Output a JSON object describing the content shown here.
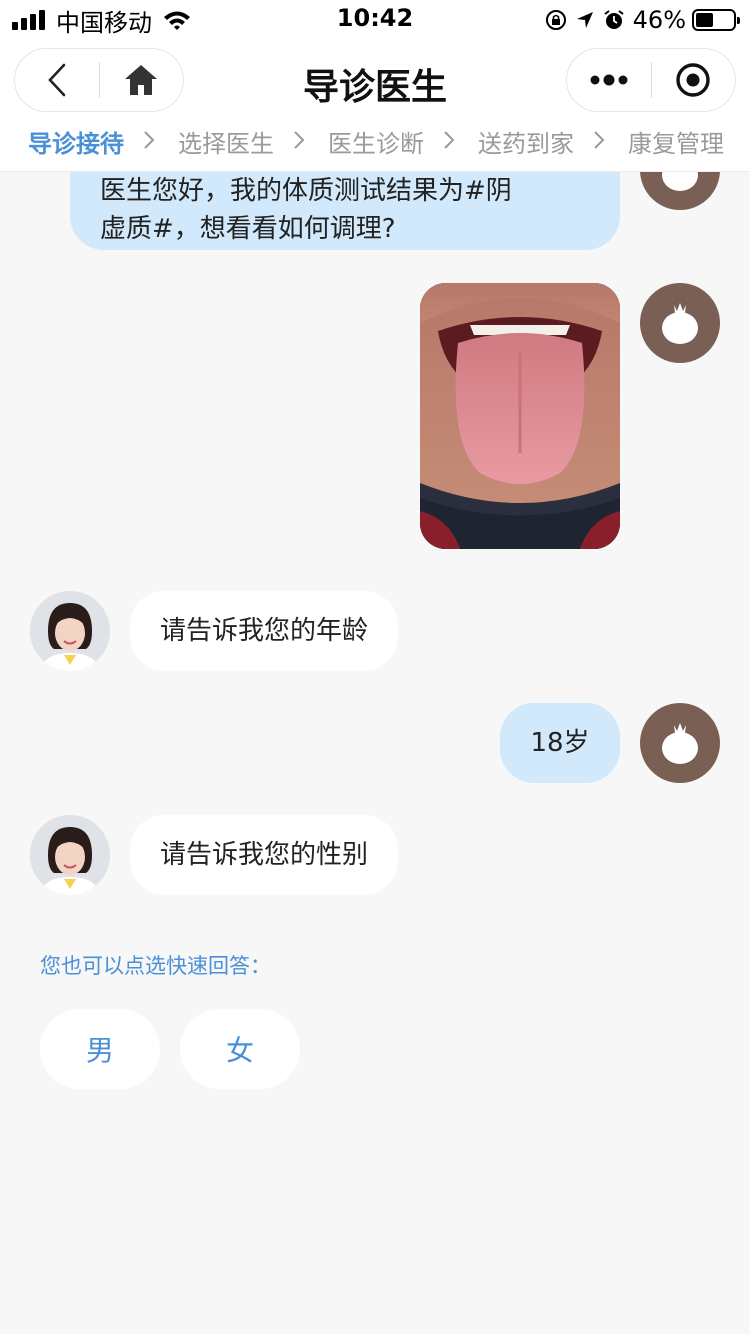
{
  "status_bar": {
    "carrier": "中国移动",
    "time": "10:42",
    "battery_percent_label": "46%",
    "battery_level": 0.46
  },
  "nav": {
    "title": "导诊医生",
    "left_icons": [
      "chevron-left-icon",
      "home-icon"
    ],
    "right_icons": [
      "more-icon",
      "record-icon"
    ]
  },
  "steps": [
    {
      "label": "导诊接待",
      "active": true
    },
    {
      "label": "选择医生",
      "active": false
    },
    {
      "label": "医生诊断",
      "active": false
    },
    {
      "label": "送药到家",
      "active": false
    },
    {
      "label": "康复管理",
      "active": false
    }
  ],
  "messages": [
    {
      "from": "user",
      "type": "text",
      "lines": [
        "医生您好，我的体质测试结果为#阴",
        "虚质#，想看看如何调理?"
      ]
    },
    {
      "from": "user",
      "type": "image",
      "subject": "tongue-photo"
    },
    {
      "from": "doctor",
      "type": "text",
      "text": "请告诉我您的年龄"
    },
    {
      "from": "user",
      "type": "text",
      "text": "18岁"
    },
    {
      "from": "doctor",
      "type": "text",
      "text": "请告诉我您的性别"
    }
  ],
  "quick_reply": {
    "hint": "您也可以点选快速回答：",
    "options": [
      "男",
      "女"
    ]
  },
  "colors": {
    "accent": "#4a90d9",
    "user_bubble": "#d1e9fb",
    "user_avatar": "#7a5f55",
    "background": "#f7f7f7"
  }
}
